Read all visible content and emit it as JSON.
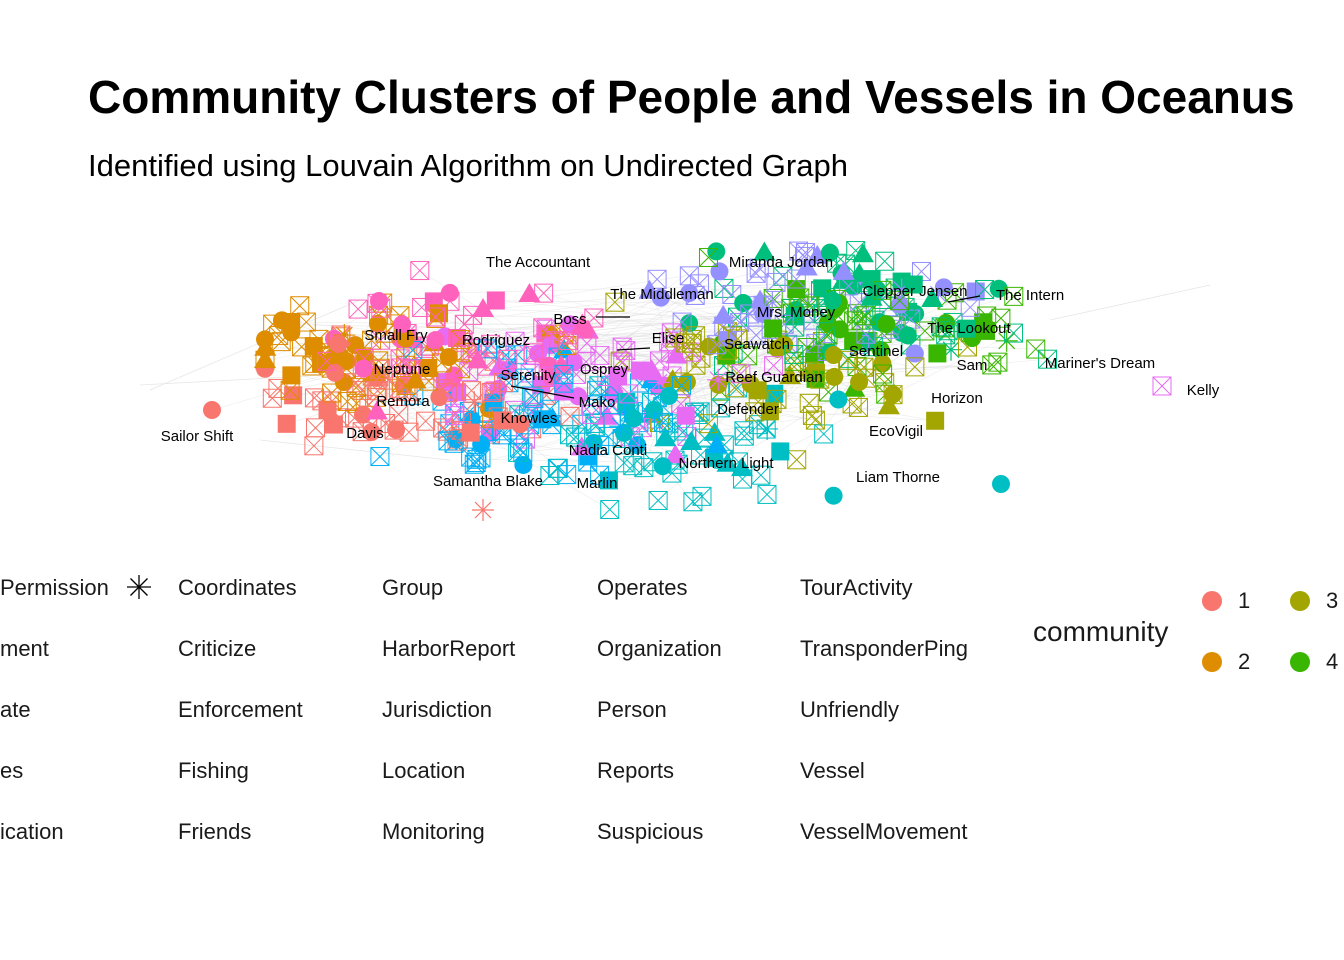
{
  "chart_data": {
    "type": "network",
    "title": "Community Clusters of People and Vessels in Oceanus",
    "subtitle": "Identified using Louvain Algorithm on Undirected Graph",
    "node_labels": [
      "The Accountant",
      "Miranda Jordan",
      "The Middleman",
      "Clepper Jensen",
      "The Intern",
      "Mrs. Money",
      "Boss",
      "Small Fry",
      "Rodriguez",
      "Elise",
      "The Lookout",
      "Seawatch",
      "Sentinel",
      "Neptune",
      "Serenity",
      "Osprey",
      "Reef Guardian",
      "Sam",
      "Mariner's Dream",
      "Kelly",
      "Remora",
      "Mako",
      "Horizon",
      "Knowles",
      "Defender",
      "Sailor Shift",
      "Davis",
      "EcoVigil",
      "Nadia Conti",
      "Northern Light",
      "Samantha Blake",
      "Marlin",
      "Liam Thorne"
    ],
    "shape_legend": {
      "items": [
        "Permission",
        "ment",
        "ate",
        "es",
        "ication",
        "Coordinates",
        "Criticize",
        "Enforcement",
        "Fishing",
        "Friends",
        "Group",
        "HarborReport",
        "Jurisdiction",
        "Location",
        "Monitoring",
        "Operates",
        "Organization",
        "Person",
        "Reports",
        "Suspicious",
        "TourActivity",
        "TransponderPing",
        "Unfriendly",
        "Vessel",
        "VesselMovement"
      ],
      "shapes": [
        "none",
        "none",
        "none",
        "none",
        "none",
        "asterisk",
        "none",
        "none",
        "none",
        "none",
        "none",
        "none",
        "none",
        "none",
        "none",
        "none",
        "none",
        "none",
        "none",
        "none",
        "none",
        "none",
        "none",
        "none",
        "none"
      ]
    },
    "color_legend": {
      "title": "community",
      "items": [
        {
          "label": "1",
          "color": "#F8766D"
        },
        {
          "label": "2",
          "color": "#DE8C00"
        },
        {
          "label": "3",
          "color": "#A3A500"
        },
        {
          "label": "4",
          "color": "#39B600"
        }
      ]
    },
    "community_colors": [
      "#F8766D",
      "#DE8C00",
      "#A3A500",
      "#39B600",
      "#00BF7D",
      "#00BFC4",
      "#00B0F6",
      "#9590FF",
      "#E76BF3",
      "#FF62BC"
    ]
  }
}
